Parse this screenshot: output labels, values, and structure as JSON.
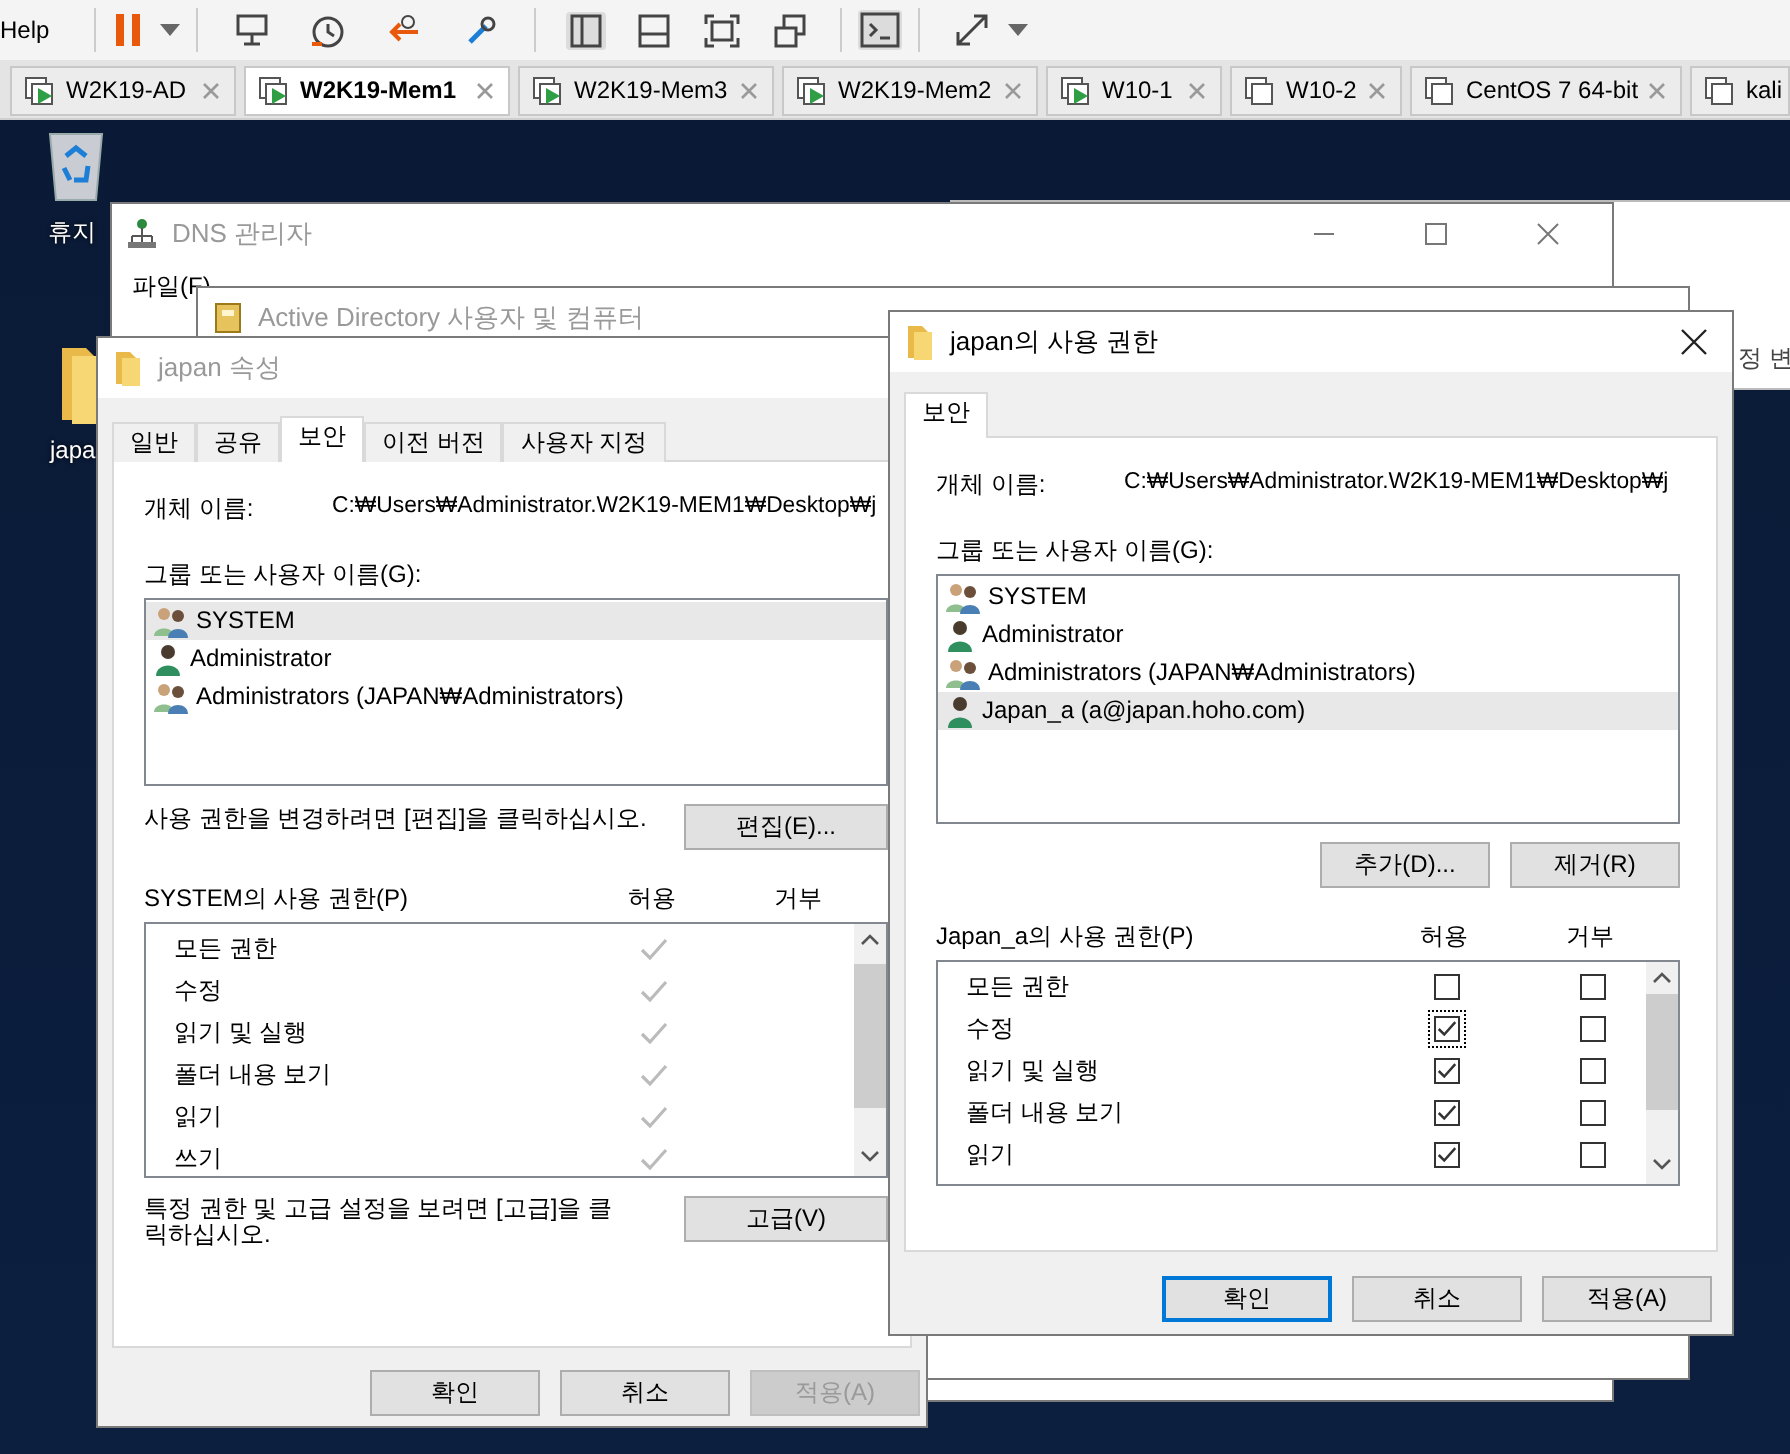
{
  "toolbar": {
    "menu": [
      "Help"
    ]
  },
  "vm_tabs": [
    {
      "label": "W2K19-AD",
      "selected": false,
      "powered_on": true,
      "show_close": true
    },
    {
      "label": "W2K19-Mem1",
      "selected": true,
      "powered_on": true,
      "show_close": true
    },
    {
      "label": "W2K19-Mem3",
      "selected": false,
      "powered_on": true,
      "show_close": true
    },
    {
      "label": "W2K19-Mem2",
      "selected": false,
      "powered_on": true,
      "show_close": true
    },
    {
      "label": "W10-1",
      "selected": false,
      "powered_on": true,
      "show_close": true
    },
    {
      "label": "W10-2",
      "selected": false,
      "powered_on": false,
      "show_close": true
    },
    {
      "label": "CentOS 7 64-bit",
      "selected": false,
      "powered_on": false,
      "show_close": true
    },
    {
      "label": "kali",
      "selected": false,
      "powered_on": false,
      "show_close": false
    }
  ],
  "desktop_icons": [
    {
      "label": "휴지",
      "kind": "recycle_bin"
    },
    {
      "label": "japa",
      "kind": "folder"
    }
  ],
  "background_window": {
    "text": "정 변"
  },
  "dns_window": {
    "title": "DNS 관리자",
    "menu": [
      "파일(F)"
    ]
  },
  "ad_window": {
    "title": "Active Directory 사용자 및 컴퓨터"
  },
  "properties_dialog": {
    "title": "japan 속성",
    "close_button": false,
    "editable": false,
    "tabs": [
      {
        "label": "일반",
        "selected": false
      },
      {
        "label": "공유",
        "selected": false
      },
      {
        "label": "보안",
        "selected": true
      },
      {
        "label": "이전 버전",
        "selected": false
      },
      {
        "label": "사용자 지정",
        "selected": false
      }
    ],
    "object_label": "개체 이름:",
    "object_path": "C:₩Users₩Administrator.W2K19-MEM1₩Desktop₩j",
    "principals_label": "그룹 또는 사용자 이름(G):",
    "principals": [
      {
        "name": "SYSTEM",
        "kind": "group",
        "selected": true
      },
      {
        "name": "Administrator",
        "kind": "user",
        "selected": false
      },
      {
        "name": "Administrators (JAPAN₩Administrators)",
        "kind": "group",
        "selected": false
      }
    ],
    "edit_hint": "사용 권한을 변경하려면 [편집]을 클릭하십시오.",
    "principal_buttons": [
      {
        "label": "편집(E)..."
      }
    ],
    "permissions_label": "SYSTEM의 사용 권한(P)",
    "allow_header": "허용",
    "deny_header": "거부",
    "permissions": [
      {
        "name": "모든 권한",
        "allow": true
      },
      {
        "name": "수정",
        "allow": true
      },
      {
        "name": "읽기 및 실행",
        "allow": true
      },
      {
        "name": "폴더 내용 보기",
        "allow": true
      },
      {
        "name": "읽기",
        "allow": true
      },
      {
        "name": "쓰기",
        "allow": true
      }
    ],
    "advanced_hint": "특정 권한 및 고급 설정을 보려면 [고급]을 클릭하십시오.",
    "advanced_button": "고급(V)",
    "buttons": [
      {
        "label": "확인",
        "disabled": false,
        "default": false
      },
      {
        "label": "취소",
        "disabled": false,
        "default": false
      },
      {
        "label": "적용(A)",
        "disabled": true,
        "default": false
      }
    ]
  },
  "permissions_dialog": {
    "title": "japan의 사용 권한",
    "close_button": true,
    "editable": true,
    "tabs": [
      {
        "label": "보안",
        "selected": true
      }
    ],
    "object_label": "개체 이름:",
    "object_path": "C:₩Users₩Administrator.W2K19-MEM1₩Desktop₩j",
    "principals_label": "그룹 또는 사용자 이름(G):",
    "principals": [
      {
        "name": "SYSTEM",
        "kind": "group",
        "selected": false
      },
      {
        "name": "Administrator",
        "kind": "user",
        "selected": false
      },
      {
        "name": "Administrators (JAPAN₩Administrators)",
        "kind": "group",
        "selected": false
      },
      {
        "name": "Japan_a (a@japan.hoho.com)",
        "kind": "user",
        "selected": true
      }
    ],
    "principal_buttons": [
      {
        "label": "추가(D)..."
      },
      {
        "label": "제거(R)"
      }
    ],
    "permissions_label": "Japan_a의 사용 권한(P)",
    "allow_header": "허용",
    "deny_header": "거부",
    "permissions": [
      {
        "name": "모든 권한",
        "allow": false,
        "deny": false,
        "focus": false
      },
      {
        "name": "수정",
        "allow": true,
        "deny": false,
        "focus": true
      },
      {
        "name": "읽기 및 실행",
        "allow": true,
        "deny": false,
        "focus": false
      },
      {
        "name": "폴더 내용 보기",
        "allow": true,
        "deny": false,
        "focus": false
      },
      {
        "name": "읽기",
        "allow": true,
        "deny": false,
        "focus": false
      }
    ],
    "buttons": [
      {
        "label": "확인",
        "disabled": false,
        "default": true
      },
      {
        "label": "취소",
        "disabled": false,
        "default": false
      },
      {
        "label": "적용(A)",
        "disabled": false,
        "default": false
      }
    ]
  }
}
